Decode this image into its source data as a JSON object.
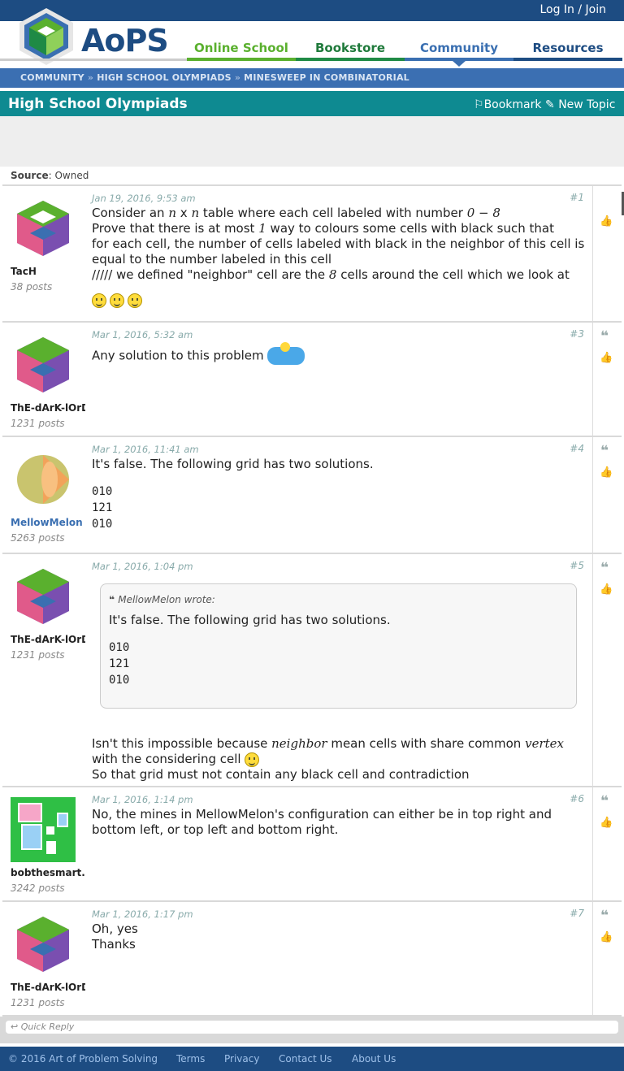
{
  "header": {
    "login": "Log In / Join",
    "logo_text": "AoPS",
    "nav": [
      "Online School",
      "Bookstore",
      "Community",
      "Resources"
    ]
  },
  "breadcrumb": {
    "items": [
      "COMMUNITY",
      "HIGH SCHOOL OLYMPIADS",
      "MINESWEEP IN COMBINATORIAL"
    ],
    "sep": "»"
  },
  "forum": {
    "title": "High School Olympiads",
    "bookmark": "Bookmark",
    "new_topic": "New Topic"
  },
  "source": {
    "label": "Source",
    "value": ": Owned"
  },
  "posts": [
    {
      "user": "TacH",
      "count": "38 posts",
      "date": "Jan 19, 2016, 9:53 am",
      "num": "#1",
      "lines": [
        "Consider an",
        "n",
        "x",
        "n",
        "table where each cell labeled with number",
        "0 − 8",
        "Prove that there is at most",
        "1",
        "way to colours some cells with black such that",
        "for each cell, the number of cells labeled with black in the neighbor of this cell is equal to the number labeled in this cell",
        "///// we defined \"neighbor\" cell are the",
        "8",
        "cells around the cell which we look at"
      ]
    },
    {
      "user": "ThE-dArK-lOrD",
      "count": "1231 posts",
      "date": "Mar 1, 2016, 5:32 am",
      "num": "#3",
      "text": "Any solution to this problem"
    },
    {
      "user": "MellowMelon",
      "count": "5263 posts",
      "date": "Mar 1, 2016, 11:41 am",
      "num": "#4",
      "text": "It's false. The following grid has two solutions.",
      "grid": [
        "010",
        "121",
        "010"
      ]
    },
    {
      "user": "ThE-dArK-lOrD",
      "count": "1231 posts",
      "date": "Mar 1, 2016, 1:04 pm",
      "num": "#5",
      "quote_head": "MellowMelon wrote:",
      "quote_text": "It's false. The following grid has two solutions.",
      "quote_grid": [
        "010",
        "121",
        "010"
      ],
      "line1a": "Isn't this impossible because",
      "math1": "neighbor",
      "line1b": "mean cells with share common",
      "math2": "vertex",
      "line2": "with the considering cell",
      "line3": "So that grid must not contain any black cell and contradiction"
    },
    {
      "user": "bobthesmart...",
      "count": "3242 posts",
      "date": "Mar 1, 2016, 1:14 pm",
      "num": "#6",
      "text": "No, the mines in MellowMelon's configuration can either be in top right and bottom left, or top left and bottom right."
    },
    {
      "user": "ThE-dArK-lOrD",
      "count": "1231 posts",
      "date": "Mar 1, 2016, 1:17 pm",
      "num": "#7",
      "line1": "Oh, yes",
      "line2": "Thanks"
    }
  ],
  "quick_reply": "Quick Reply",
  "footer": [
    "© 2016 Art of Problem Solving",
    "Terms",
    "Privacy",
    "Contact Us",
    "About Us"
  ],
  "colors": {
    "brand": "#1d4c82",
    "forum_header": "#0e8a91",
    "breadcrumb": "#3b6fb2"
  }
}
